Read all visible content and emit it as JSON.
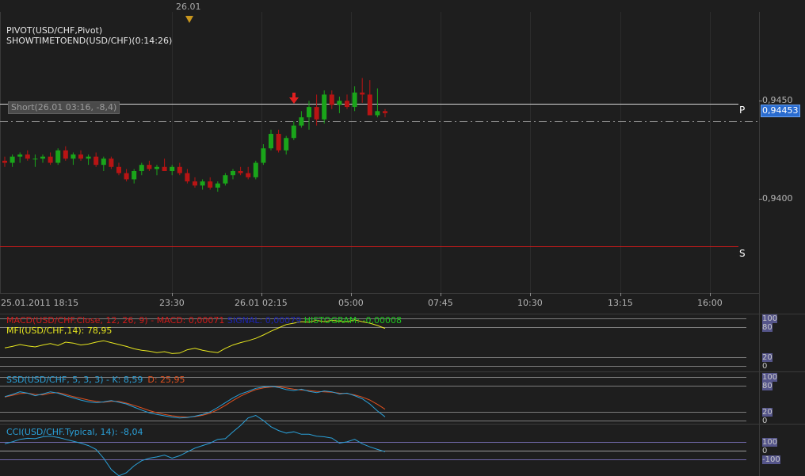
{
  "chart": {
    "title_lines": [
      "PIVOT(USD/CHF,Pivot)",
      "SHOWTIMETOEND(USD/CHF)(0:14:26)"
    ],
    "top_marker_label": "26.01",
    "trade_label": "Short(26.01 03:16, -8,4)",
    "price_ticks": [
      "0,9450",
      "0,9400"
    ],
    "current_price": "0,94453",
    "pivot_levels": [
      {
        "label": "P",
        "price": 0.9451,
        "color": "#d8d8d8"
      },
      {
        "label": "S",
        "price": 0.93855,
        "color": "#d01a1a"
      }
    ],
    "time_labels": [
      "25.01.2011 18:15",
      "23:30",
      "26.01 02:15",
      "05:00",
      "07:45",
      "10:30",
      "13:15",
      "16:00"
    ],
    "colors": {
      "up": "#1aa51a",
      "down": "#b81414",
      "bg": "#1e1e1e"
    }
  },
  "chart_data": {
    "type": "candlestick",
    "ylim": [
      0.9358,
      0.9494
    ],
    "candles": [
      [
        0.9422,
        0.9424,
        0.9419,
        0.9421
      ],
      [
        0.9421,
        0.9425,
        0.9419,
        0.9424
      ],
      [
        0.9424,
        0.9426,
        0.9421,
        0.9425
      ],
      [
        0.9425,
        0.9427,
        0.9422,
        0.9423
      ],
      [
        0.9423,
        0.9425,
        0.9419,
        0.9423
      ],
      [
        0.9423,
        0.9425,
        0.9421,
        0.9424
      ],
      [
        0.9424,
        0.9426,
        0.942,
        0.9421
      ],
      [
        0.9421,
        0.9428,
        0.942,
        0.9427
      ],
      [
        0.9427,
        0.9429,
        0.9422,
        0.9423
      ],
      [
        0.9423,
        0.9426,
        0.942,
        0.9425
      ],
      [
        0.9425,
        0.9427,
        0.9422,
        0.9423
      ],
      [
        0.9423,
        0.9425,
        0.942,
        0.9424
      ],
      [
        0.9424,
        0.9426,
        0.9419,
        0.942
      ],
      [
        0.942,
        0.9424,
        0.9417,
        0.9423
      ],
      [
        0.9423,
        0.9424,
        0.9418,
        0.9419
      ],
      [
        0.9419,
        0.9421,
        0.9415,
        0.9416
      ],
      [
        0.9416,
        0.9418,
        0.9412,
        0.9413
      ],
      [
        0.9413,
        0.9418,
        0.9411,
        0.9417
      ],
      [
        0.9417,
        0.9421,
        0.9415,
        0.942
      ],
      [
        0.942,
        0.9422,
        0.9417,
        0.9418
      ],
      [
        0.9418,
        0.942,
        0.9415,
        0.9419
      ],
      [
        0.9419,
        0.9423,
        0.9417,
        0.9417
      ],
      [
        0.9417,
        0.942,
        0.9415,
        0.9419
      ],
      [
        0.9419,
        0.9421,
        0.9415,
        0.9416
      ],
      [
        0.9416,
        0.9418,
        0.9411,
        0.9412
      ],
      [
        0.9412,
        0.9414,
        0.9409,
        0.941
      ],
      [
        0.941,
        0.9413,
        0.9408,
        0.9412
      ],
      [
        0.9412,
        0.9414,
        0.9408,
        0.9409
      ],
      [
        0.9409,
        0.9412,
        0.9407,
        0.9411
      ],
      [
        0.9411,
        0.9416,
        0.941,
        0.9415
      ],
      [
        0.9415,
        0.9418,
        0.9413,
        0.9417
      ],
      [
        0.9417,
        0.9419,
        0.9415,
        0.9416
      ],
      [
        0.9416,
        0.9419,
        0.9413,
        0.9414
      ],
      [
        0.9414,
        0.9422,
        0.9413,
        0.9421
      ],
      [
        0.9421,
        0.943,
        0.942,
        0.9428
      ],
      [
        0.9428,
        0.9437,
        0.9427,
        0.9435
      ],
      [
        0.9435,
        0.9437,
        0.9426,
        0.9427
      ],
      [
        0.9427,
        0.9434,
        0.9425,
        0.9433
      ],
      [
        0.9433,
        0.9441,
        0.9432,
        0.9439
      ],
      [
        0.9439,
        0.9446,
        0.9438,
        0.9443
      ],
      [
        0.9443,
        0.9451,
        0.9437,
        0.9448
      ],
      [
        0.9448,
        0.9454,
        0.9439,
        0.9442
      ],
      [
        0.9442,
        0.9456,
        0.944,
        0.9454
      ],
      [
        0.9454,
        0.9456,
        0.9447,
        0.9449
      ],
      [
        0.9449,
        0.9453,
        0.9445,
        0.9451
      ],
      [
        0.9451,
        0.9454,
        0.9447,
        0.9448
      ],
      [
        0.9448,
        0.9458,
        0.9446,
        0.9455
      ],
      [
        0.9455,
        0.9462,
        0.945,
        0.9454
      ],
      [
        0.9454,
        0.9461,
        0.9445,
        0.9444
      ],
      [
        0.9444,
        0.9457,
        0.9443,
        0.9446
      ],
      [
        0.9446,
        0.9447,
        0.9443,
        0.9445
      ]
    ],
    "mfi": {
      "legend": "MFI(USD/CHF,14): 78,95",
      "values": [
        38,
        41,
        45,
        42,
        40,
        44,
        47,
        43,
        50,
        48,
        44,
        46,
        50,
        53,
        49,
        45,
        41,
        36,
        33,
        31,
        28,
        30,
        26,
        27,
        34,
        37,
        33,
        30,
        28,
        37,
        44,
        49,
        53,
        58,
        65,
        73,
        80,
        87,
        90,
        93,
        92,
        96,
        93,
        96,
        94,
        93,
        97,
        93,
        90,
        85,
        79
      ]
    },
    "macd_legend": [
      "MACD(USD/CHF.Close, 12, 26, 9) - ",
      "MACD: 0,00071",
      " ",
      "SIGNAL: 0,00079",
      " ",
      "HISTOGRAM: -0,00008"
    ],
    "ssd": {
      "legend_prefix": "SSD(USD/CHF, 5, 3, 3) - ",
      "k_label": "K: 8,59",
      "d_label": "D: 25,95",
      "k_values": [
        55,
        60,
        66,
        63,
        57,
        61,
        66,
        63,
        57,
        52,
        47,
        43,
        41,
        43,
        46,
        42,
        38,
        31,
        24,
        18,
        14,
        11,
        8,
        6,
        7,
        10,
        14,
        20,
        30,
        41,
        52,
        61,
        67,
        74,
        77,
        79,
        76,
        71,
        69,
        72,
        67,
        64,
        68,
        66,
        61,
        63,
        57,
        50,
        38,
        22,
        8.59
      ],
      "d_values": [
        54,
        58,
        62,
        63,
        60,
        59,
        63,
        64,
        60,
        55,
        51,
        47,
        44,
        42,
        44,
        44,
        40,
        35,
        29,
        23,
        18,
        14,
        11,
        9,
        8,
        9,
        12,
        17,
        25,
        35,
        46,
        56,
        64,
        71,
        75,
        77,
        78,
        75,
        72,
        70,
        69,
        67,
        66,
        65,
        63,
        62,
        59,
        54,
        47,
        37,
        25.95
      ]
    },
    "cci": {
      "legend": "CCI(USD/CHF.Typical, 14): -8,04",
      "values": [
        55,
        70,
        90,
        98,
        95,
        110,
        115,
        105,
        90,
        75,
        60,
        40,
        10,
        -60,
        -150,
        -200,
        -175,
        -120,
        -80,
        -60,
        -50,
        -35,
        -60,
        -40,
        -10,
        20,
        40,
        60,
        90,
        95,
        150,
        200,
        260,
        280,
        240,
        190,
        160,
        140,
        150,
        130,
        130,
        115,
        110,
        100,
        60,
        70,
        90,
        55,
        30,
        10,
        -8.04
      ]
    }
  },
  "panes": {
    "macd_mfi": {
      "ticks": [
        "100",
        "80",
        "20",
        "0"
      ]
    },
    "ssd": {
      "ticks": [
        "100",
        "80",
        "20",
        "0"
      ]
    },
    "cci": {
      "ticks": [
        "100",
        "0",
        "-100"
      ]
    }
  }
}
